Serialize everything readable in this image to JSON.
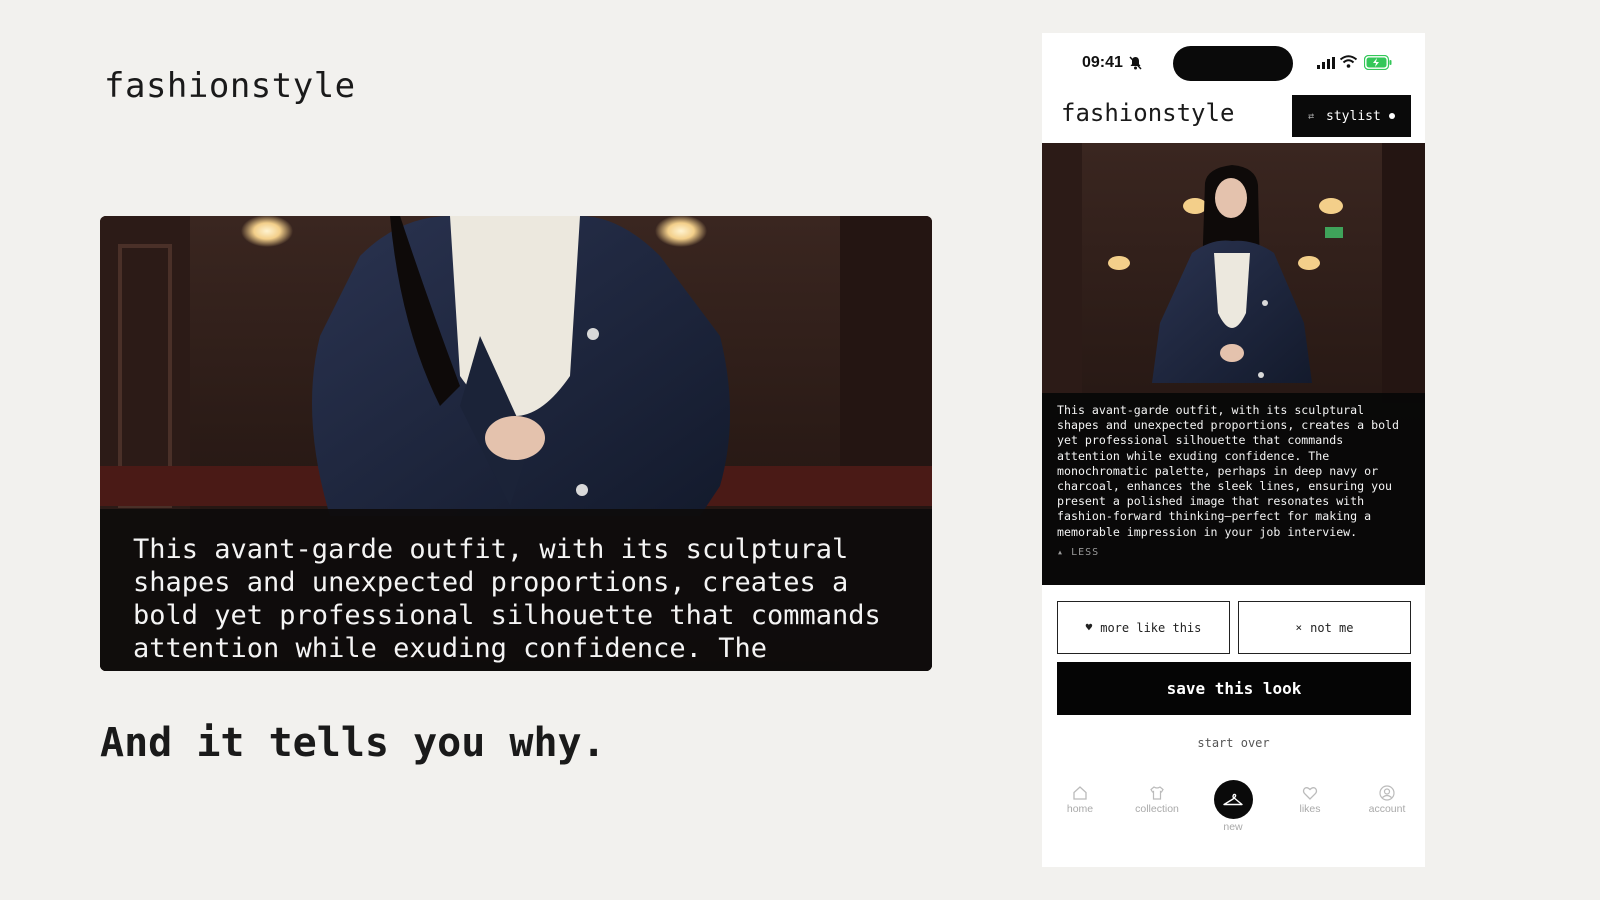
{
  "presentation": {
    "brand": "fashionstyle",
    "hero_caption": "This avant-garde outfit, with its sculptural shapes and unexpected proportions, creates a bold yet professional silhouette that commands attention while exuding confidence. The",
    "tagline": "And it tells you why."
  },
  "phone": {
    "status": {
      "time": "09:41",
      "icons": [
        "bell-muted-icon",
        "signal-icon",
        "wifi-icon",
        "battery-charging-icon"
      ],
      "battery_color": "#34c759"
    },
    "header": {
      "brand": "fashionstyle",
      "stylist_label": "stylist"
    },
    "look": {
      "description": "This avant-garde outfit, with its sculptural shapes and unexpected proportions, creates a bold yet professional silhouette that commands attention while exuding confidence. The monochromatic palette, perhaps in deep navy or charcoal, enhances the sleek lines, ensuring you present a polished image that resonates with fashion-forward thinking—perfect for making a memorable impression in your job interview.",
      "less_label": "LESS",
      "less_icon": "▴"
    },
    "actions": {
      "more_like_this": "more like this",
      "more_icon": "♥",
      "not_me": "not me",
      "not_me_icon": "×",
      "save": "save this look",
      "start_over": "start over"
    },
    "tabs": [
      {
        "label": "home",
        "icon": "home-icon"
      },
      {
        "label": "collection",
        "icon": "shirt-icon"
      },
      {
        "label": "new",
        "icon": "hanger-icon",
        "active": true
      },
      {
        "label": "likes",
        "icon": "heart-icon"
      },
      {
        "label": "account",
        "icon": "account-icon"
      }
    ],
    "accent": "#000000"
  }
}
